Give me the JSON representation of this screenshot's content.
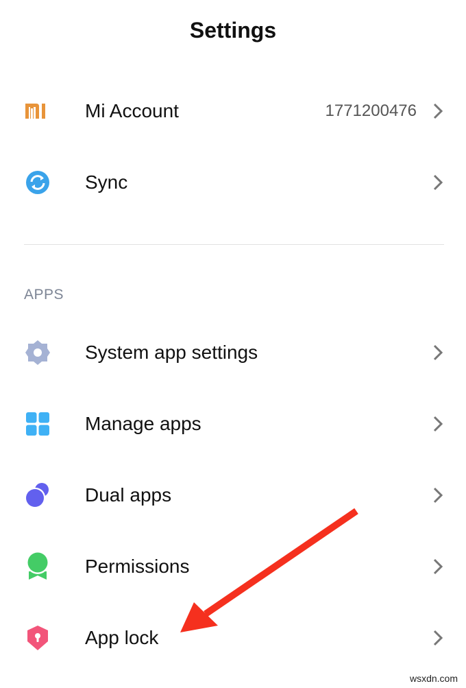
{
  "header": {
    "title": "Settings"
  },
  "account_items": [
    {
      "label": "Mi Account",
      "value": "1771200476",
      "icon": "mi-logo-icon"
    },
    {
      "label": "Sync",
      "icon": "sync-icon"
    }
  ],
  "apps_section": {
    "heading": "APPS",
    "items": [
      {
        "label": "System app settings",
        "icon": "gear-icon"
      },
      {
        "label": "Manage apps",
        "icon": "grid-icon"
      },
      {
        "label": "Dual apps",
        "icon": "dual-circles-icon"
      },
      {
        "label": "Permissions",
        "icon": "badge-icon"
      },
      {
        "label": "App lock",
        "icon": "shield-lock-icon"
      }
    ]
  },
  "colors": {
    "mi_orange": "#e8943a",
    "sync_blue": "#3aa3ea",
    "gear_gray": "#a5b2d4",
    "grid_blue": "#3fb1f5",
    "dual_purple": "#6260ee",
    "badge_green": "#44cc66",
    "shield_pink": "#f2557a",
    "annotation_red": "#f5301e"
  },
  "watermark": "wsxdn.com"
}
